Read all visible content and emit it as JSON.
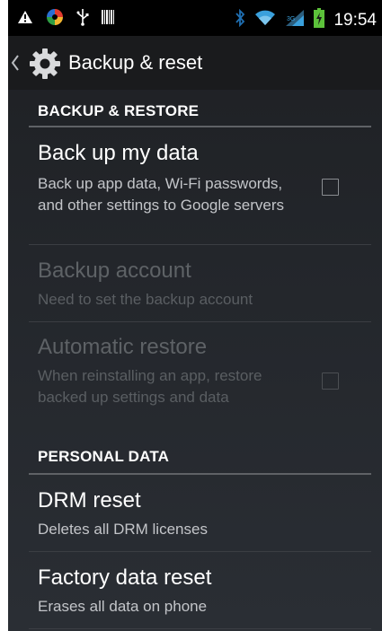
{
  "status_bar": {
    "time": "19:54",
    "icons": [
      "warning-icon",
      "app-notification-icon",
      "usb-icon",
      "barcode-icon",
      "bluetooth-icon",
      "wifi-icon",
      "signal-icon",
      "battery-charging-icon"
    ]
  },
  "action_bar": {
    "title": "Backup & reset",
    "icon": "gear-icon"
  },
  "sections": {
    "backup_restore": {
      "header": "BACKUP & RESTORE",
      "back_up_data": {
        "title": "Back up my data",
        "summary": "Back up app data, Wi-Fi passwords, and other settings to Google servers",
        "checked": false
      },
      "backup_account": {
        "title": "Backup account",
        "summary": "Need to set the backup account"
      },
      "automatic_restore": {
        "title": "Automatic restore",
        "summary": "When reinstalling an app, restore backed up settings and data",
        "checked": false
      }
    },
    "personal_data": {
      "header": "PERSONAL DATA",
      "drm_reset": {
        "title": "DRM reset",
        "summary": "Deletes all DRM licenses"
      },
      "factory_reset": {
        "title": "Factory data reset",
        "summary": "Erases all data on phone"
      }
    }
  },
  "colors": {
    "status_bar": "#000000",
    "action_bar": "#1a1b1d",
    "background": "#23262b",
    "text_primary": "#ffffff",
    "text_secondary": "#c3c5c9",
    "text_disabled": "#5e6266",
    "battery_green": "#5cc23a",
    "bluetooth_blue": "#1f6fb2",
    "wifi_blue": "#3aa0dc",
    "signal_blue": "#3aa0dc"
  }
}
